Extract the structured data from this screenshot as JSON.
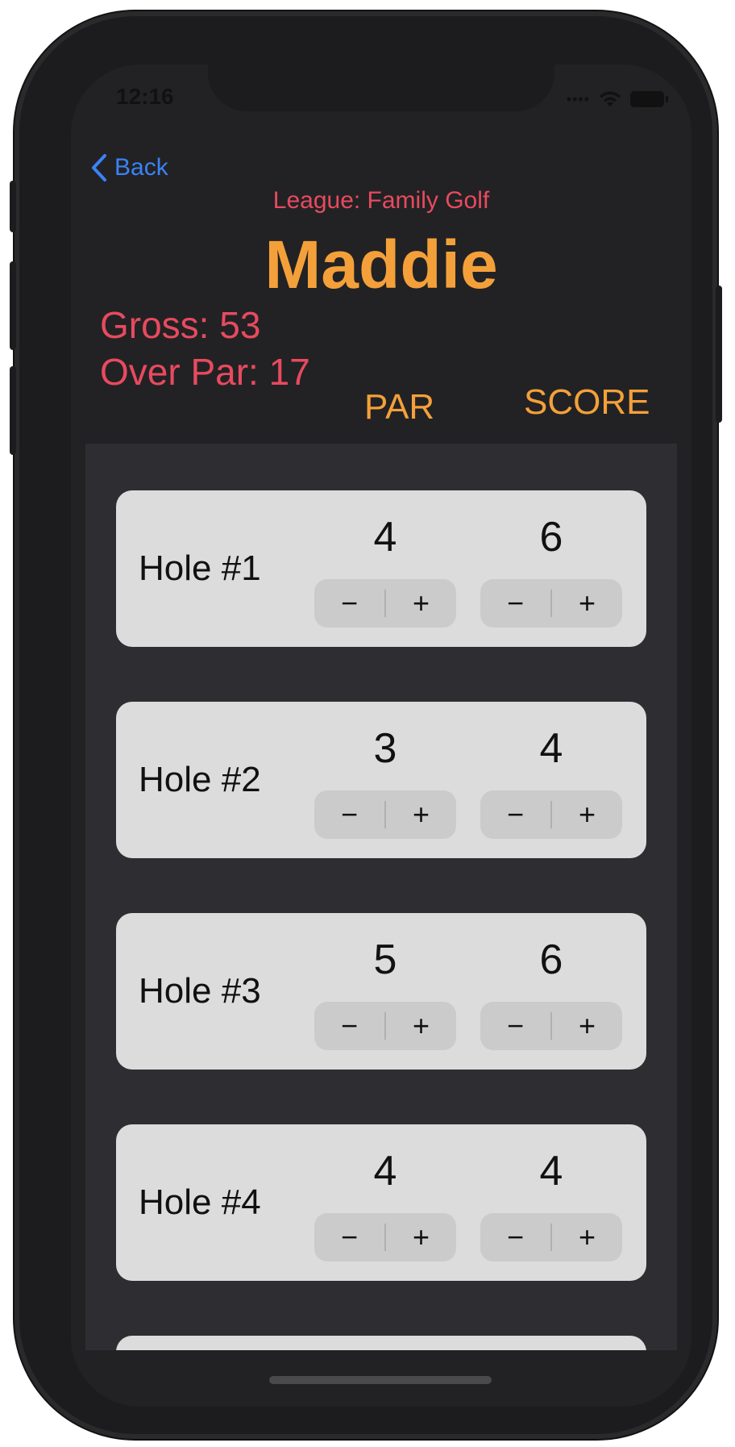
{
  "status_bar": {
    "time": "12:16",
    "signal": "••••"
  },
  "nav": {
    "back_label": "Back"
  },
  "header": {
    "league": "League: Family Golf",
    "player_name": "Maddie",
    "gross": "Gross: 53",
    "over_par": "Over Par: 17",
    "col_par": "PAR",
    "col_score": "SCORE"
  },
  "holes": [
    {
      "label": "Hole #1",
      "par": "4",
      "score": "6"
    },
    {
      "label": "Hole #2",
      "par": "3",
      "score": "4"
    },
    {
      "label": "Hole #3",
      "par": "5",
      "score": "6"
    },
    {
      "label": "Hole #4",
      "par": "4",
      "score": "4"
    }
  ],
  "stepper": {
    "minus": "−",
    "plus": "+"
  },
  "colors": {
    "accent_orange": "#f4a03a",
    "accent_red": "#e84a5f",
    "link_blue": "#3b82f6"
  }
}
